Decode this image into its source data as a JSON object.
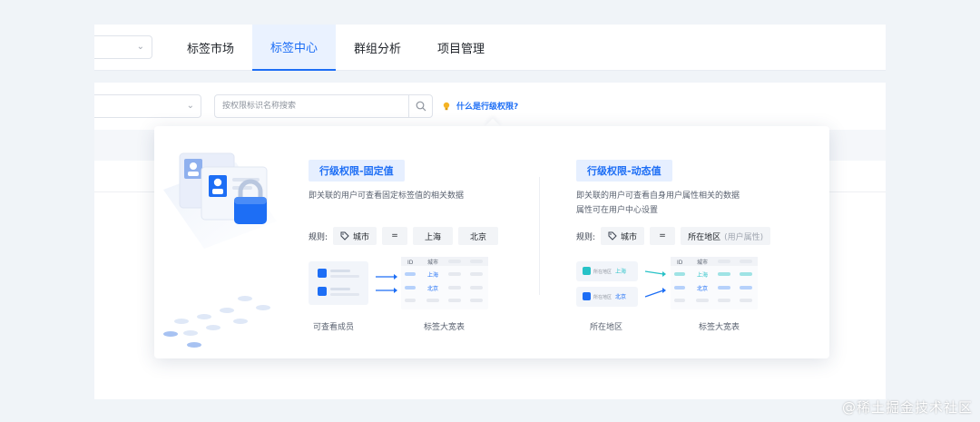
{
  "nav": {
    "tabs": [
      {
        "label": "标签市场"
      },
      {
        "label": "标签中心"
      },
      {
        "label": "群组分析"
      },
      {
        "label": "项目管理"
      }
    ],
    "active_index": 1
  },
  "filter": {
    "search_placeholder": "按权限标识名称搜索",
    "help_label": "什么是行级权限?"
  },
  "popover": {
    "fixed": {
      "title": "行级权限-固定值",
      "description_lines": [
        "即关联的用户可查看固定标签值的相关数据"
      ],
      "rule_label": "规则:",
      "rule_field": "城市",
      "rule_op": "=",
      "rule_values": [
        "上海",
        "北京"
      ],
      "left_caption": "可查看成员",
      "right_caption": "标签大宽表",
      "table_header": [
        "ID",
        "城市"
      ],
      "table_values": [
        "上海",
        "北京"
      ]
    },
    "dynamic": {
      "title": "行级权限-动态值",
      "description_lines": [
        "即关联的用户可查看自身用户属性相关的数据",
        "属性可在用户中心设置"
      ],
      "rule_label": "规则:",
      "rule_field": "城市",
      "rule_op": "=",
      "rule_value": "所在地区",
      "rule_value_hint": "(用户属性)",
      "users": [
        {
          "label": "所在地区",
          "value": "上海"
        },
        {
          "label": "所在地区",
          "value": "北京"
        }
      ],
      "left_caption": "所在地区",
      "right_caption": "标签大宽表",
      "table_header": [
        "ID",
        "城市"
      ],
      "table_values": [
        "上海",
        "北京"
      ]
    }
  },
  "watermark": "@稀土掘金技术社区",
  "colors": {
    "accent": "#1d6ef5",
    "teal": "#27c2c7",
    "page_bg": "#f0f4f8"
  }
}
